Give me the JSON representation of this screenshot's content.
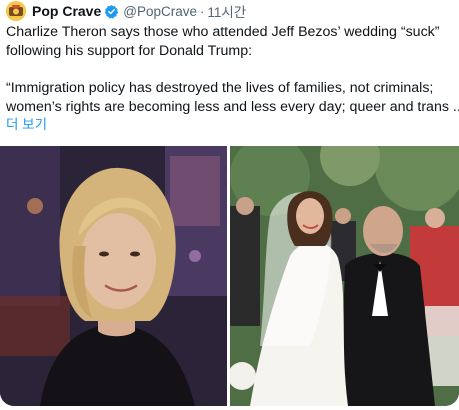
{
  "tweet": {
    "display_name": "Pop Crave",
    "handle": "@PopCrave",
    "separator": "·",
    "time": "11시간",
    "lines": [
      "Charlize Theron says those who attended Jeff Bezos’ wedding “suck”",
      "following his support for Donald Trump:",
      "“Immigration policy has destroyed the lives of families, not criminals;",
      "women’s rights are becoming less and less every day; queer and trans ..."
    ],
    "show_more": "더 보기"
  },
  "icons": {
    "avatar": "pop-crave-avatar",
    "verified": "verified-badge-icon"
  },
  "colors": {
    "verified": "#1d9bf0",
    "link": "#1d9bf0",
    "secondary_text": "#536471"
  },
  "media": {
    "left_image": "photo-charlize-theron",
    "right_image": "photo-bezos-wedding"
  }
}
